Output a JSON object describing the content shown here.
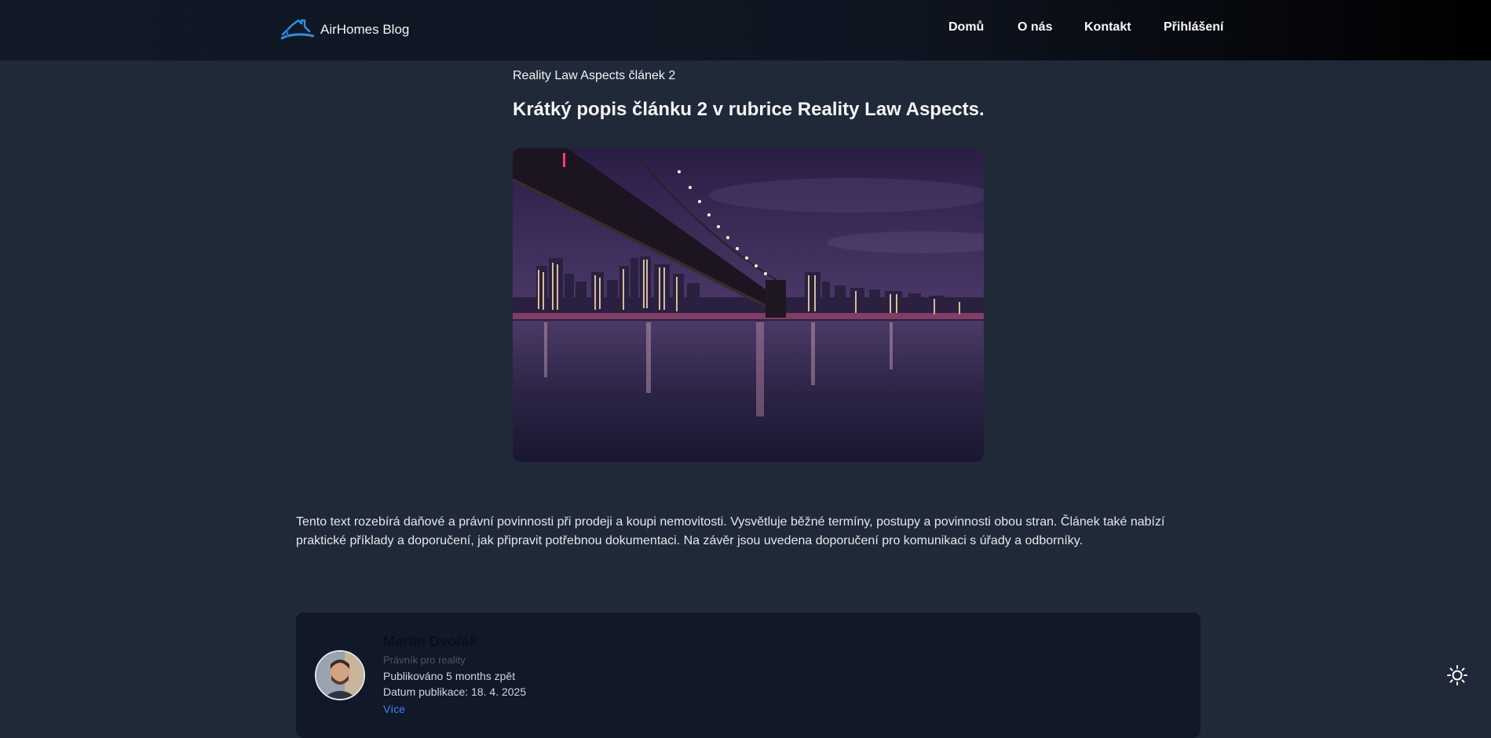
{
  "header": {
    "brand": "AirHomes Blog",
    "nav": [
      {
        "label": "Domů"
      },
      {
        "label": "O nás"
      },
      {
        "label": "Kontakt"
      },
      {
        "label": "Přihlášení"
      }
    ]
  },
  "article": {
    "category": "Reality Law Aspects článek 2",
    "title": "Krátký popis článku 2 v rubrice Reality Law Aspects.",
    "image_icon": "city-bridge-night-photo",
    "body": "Tento text rozebírá daňové a právní povinnosti při prodeji a koupi nemovitosti. Vysvětluje běžné termíny, postupy a povinnosti obou stran. Článek také nabízí praktické příklady a doporučení, jak připravit potřebnou dokumentaci. Na závěr jsou uvedena doporučení pro komunikaci s úřady a odborníky."
  },
  "author": {
    "name": "Martin Dvořák",
    "role": "Právník pro reality",
    "published": "Publikováno 5 months zpět",
    "date": "Datum publikace: 18. 4. 2025",
    "link": "Více"
  },
  "theme_toggle": {
    "icon": "sun-icon"
  },
  "colors": {
    "background": "#1f2937",
    "header": "#111827",
    "card": "#111827",
    "accent": "#3b82f6",
    "logo": "#2f8fe0"
  }
}
